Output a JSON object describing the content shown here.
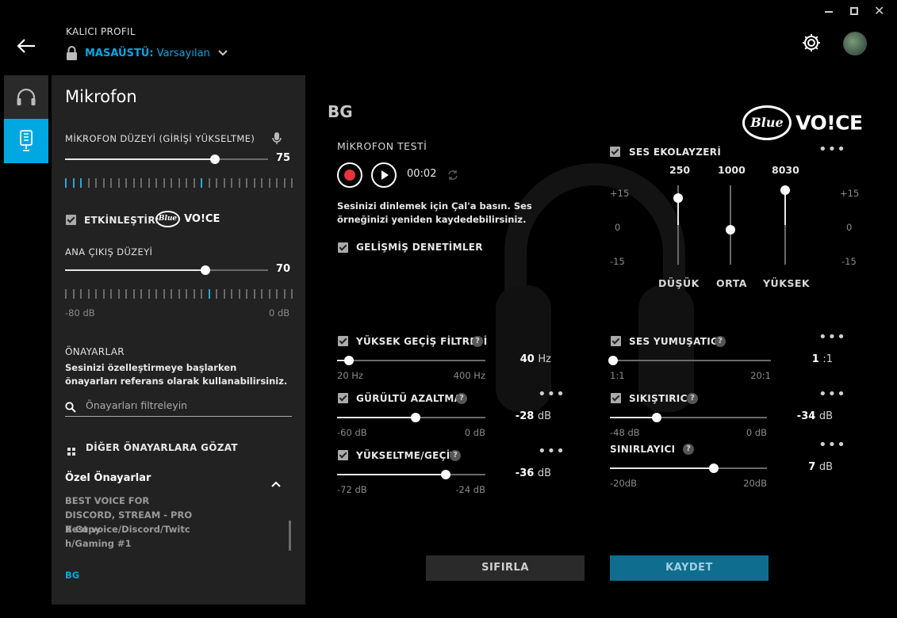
{
  "header": {
    "profile_label": "KALICI PROFIL",
    "profile_name_prefix": "MASAÜSTÜ:",
    "profile_name_value": "Varsayılan"
  },
  "left_panel": {
    "title": "Mikrofon",
    "mic_level_label": "MİKROFON DÜZEYİ (GİRİŞİ YÜKSELTME)",
    "mic_level_value": "75",
    "mic_level_fraction": 0.74,
    "enable_label": "ETKİNLEŞTİR:",
    "main_output_label": "ANA ÇIKIŞ DÜZEYİ",
    "main_output_value": "70",
    "main_output_fraction": 0.69,
    "output_min": "-80 dB",
    "output_max": "0 dB",
    "presets_heading": "ÖNAYARLAR",
    "presets_desc": "Sesinizi özelleştirmeye başlarken önayarları referans olarak kullanabilirsiniz.",
    "search_placeholder": "Önayarları filtreleyin",
    "browse_label": "DİĞER ÖNAYARLARA GÖZAT",
    "custom_presets_label": "Özel Önayarlar",
    "presets": [
      "BEST VOICE FOR DISCORD, STREAM - PRO X Copy",
      "Best voice/Discord/Twitch/Gaming #1",
      "BG"
    ]
  },
  "main": {
    "preset_title": "BG",
    "brand_blue": "Blue",
    "brand_voice": "VO!CE",
    "mic_test_label": "MİKROFON TESTİ",
    "test_time": "00:02",
    "test_hint": "Sesinizi dinlemek için Çal'a basın. Ses örneğinizi yeniden kaydedebilirsiniz.",
    "advanced_label": "GELİŞMİŞ DENETİMLER",
    "eq": {
      "label": "SES EKOLAYZERİ",
      "bands": [
        {
          "freq": "250",
          "name": "DÜŞÜK",
          "level": 0.9
        },
        {
          "freq": "1000",
          "name": "ORTA",
          "level": 0.5
        },
        {
          "freq": "8030",
          "name": "YÜKSEK",
          "level": 1.0
        }
      ],
      "scale_top": "+15",
      "scale_mid": "0",
      "scale_bottom": "-15"
    },
    "high_pass": {
      "label": "YÜKSEK GEÇİŞ FİLTRESİ",
      "value": "40",
      "unit": "Hz",
      "min": "20 Hz",
      "max": "400 Hz",
      "fraction": 0.08
    },
    "noise_reduction": {
      "label": "GÜRÜLTÜ AZALTMA",
      "value": "-28",
      "unit": "dB",
      "min": "-60 dB",
      "max": "0 dB",
      "fraction": 0.53
    },
    "expander": {
      "label": "YÜKSELTME/GEÇİT",
      "value": "-36",
      "unit": "dB",
      "min": "-72 dB",
      "max": "-24 dB",
      "fraction": 0.73
    },
    "de_esser": {
      "label": "SES YUMUŞATICI",
      "value": "1",
      "unit": ":1",
      "min": "1:1",
      "max": "20:1",
      "fraction": 0.02
    },
    "compressor": {
      "label": "SIKIŞTIRICI",
      "value": "-34",
      "unit": "dB",
      "min": "-48 dB",
      "max": "0 dB",
      "fraction": 0.3
    },
    "limiter": {
      "label": "SINIRLAYICI",
      "value": "7",
      "unit": "dB",
      "min": "-20dB",
      "max": "20dB",
      "fraction": 0.66
    },
    "reset_label": "SIFIRLA",
    "save_label": "KAYDET"
  },
  "colors": {
    "accent": "#00a8e1",
    "save_bg": "#0f6d8f",
    "panel": "#222222"
  }
}
